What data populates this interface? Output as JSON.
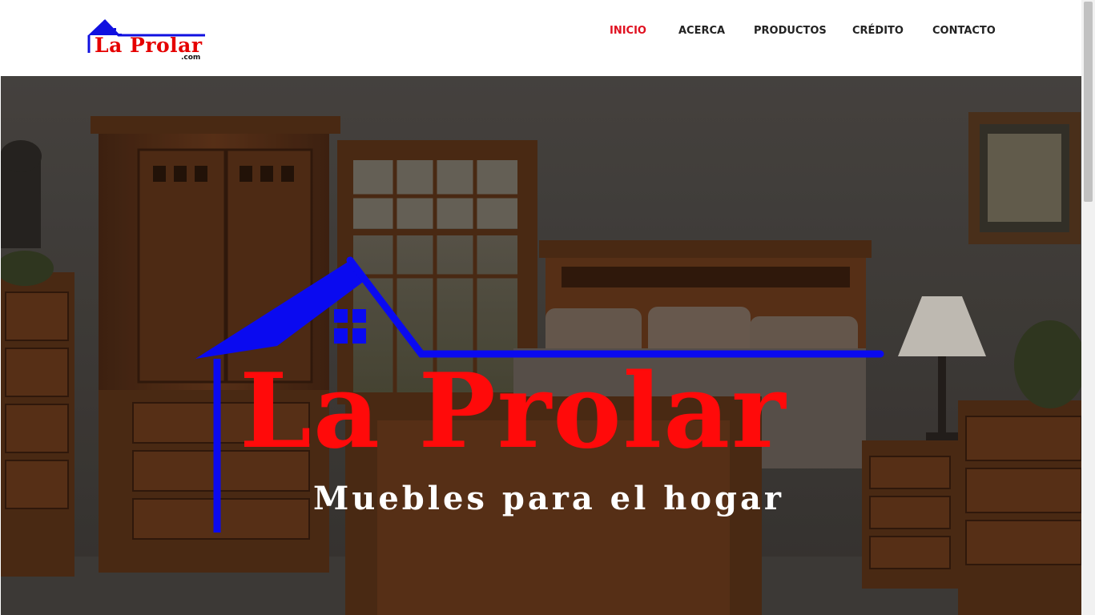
{
  "brand": {
    "name": "La Prolar",
    "tld": ".com",
    "colors": {
      "roof": "#1010e0",
      "text": "#e50000"
    }
  },
  "nav": {
    "items": [
      {
        "label": "INICIO",
        "active": true
      },
      {
        "label": "ACERCA",
        "active": false
      },
      {
        "label": "PRODUCTOS",
        "active": false
      },
      {
        "label": "CRÉDITO",
        "active": false
      },
      {
        "label": "CONTACTO",
        "active": false
      }
    ],
    "colors": {
      "active": "#e01020",
      "default": "#222222"
    }
  },
  "hero": {
    "title": "La Prolar",
    "tagline": "Muebles para el hogar",
    "colors": {
      "title": "#ff0a0a",
      "roof": "#0a0af0",
      "tagline": "#ffffff"
    }
  }
}
